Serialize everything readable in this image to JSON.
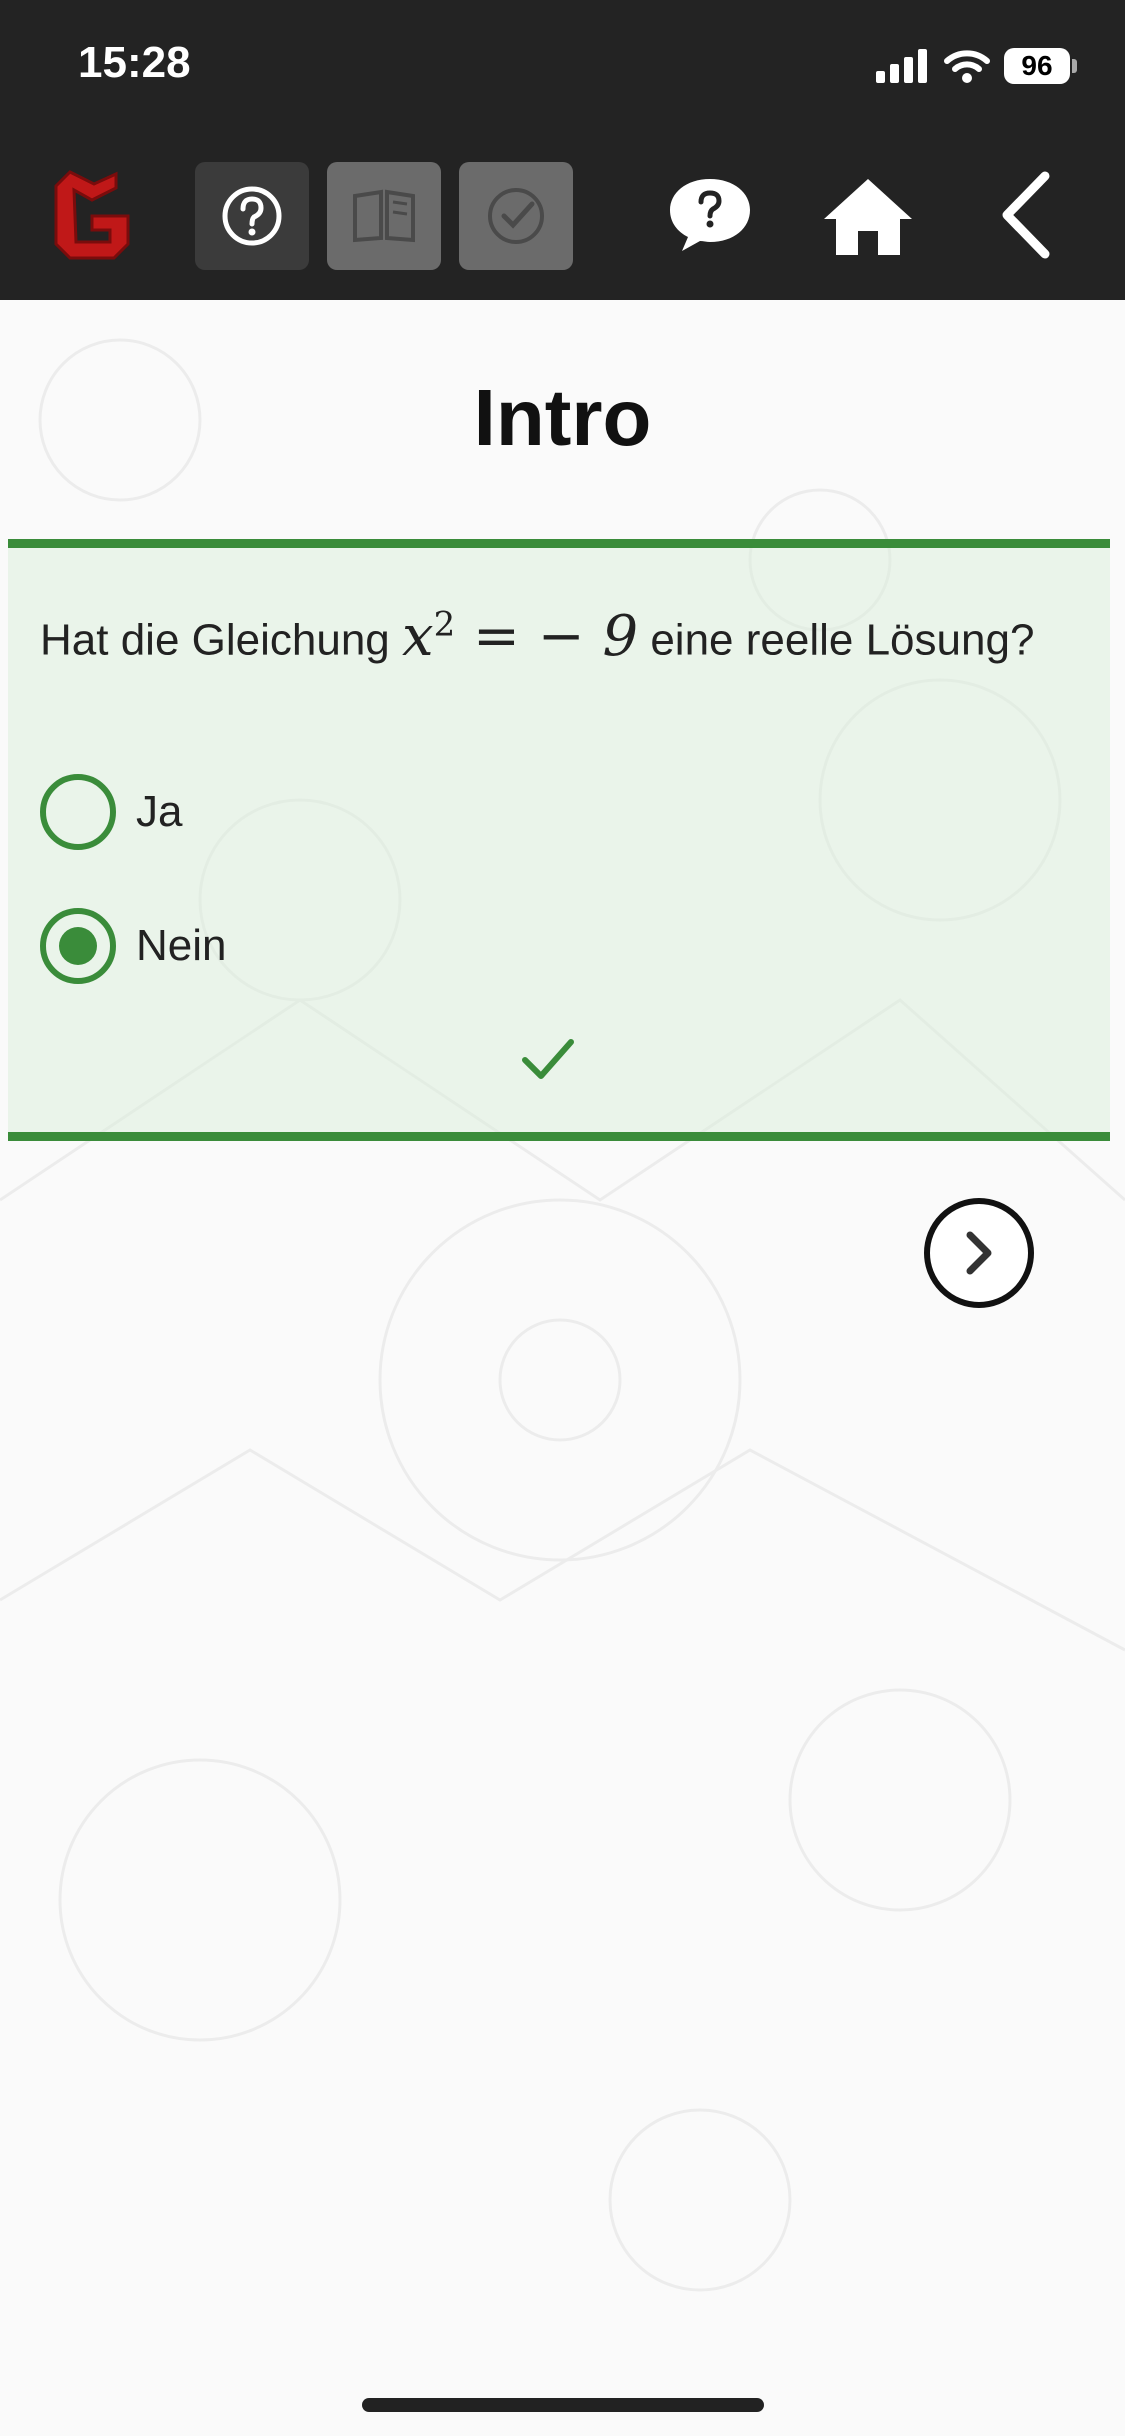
{
  "status_bar": {
    "time": "15:28",
    "battery": "96"
  },
  "toolbar": {
    "logo": "logo",
    "tools": [
      "help-icon",
      "book-icon",
      "checkmark-circle-icon"
    ],
    "nav": [
      "chat-help-icon",
      "home-icon",
      "back-arrow-icon"
    ]
  },
  "page": {
    "title": "Intro"
  },
  "question": {
    "text_before": "Hat die Gleichung ",
    "math": "x² = − 9",
    "text_after": " eine reelle Lösung?",
    "options": [
      {
        "label": "Ja",
        "selected": false
      },
      {
        "label": "Nein",
        "selected": true
      }
    ],
    "result_icon": "checkmark-icon"
  },
  "colors": {
    "accent": "#3a8c3a",
    "topbar": "#232323",
    "logo": "#c01818"
  }
}
